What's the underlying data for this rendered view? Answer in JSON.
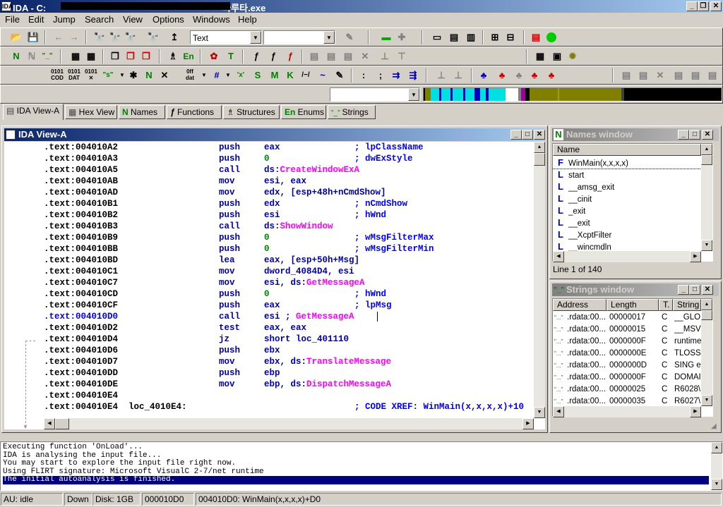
{
  "app": {
    "title": "IDA - C:",
    "title_suffix": "마루타.exe",
    "icon_text": "IDA"
  },
  "menu": [
    "File",
    "Edit",
    "Jump",
    "Search",
    "View",
    "Options",
    "Windows",
    "Help"
  ],
  "toolbar": {
    "segment_combo": "Text",
    "second_combo": ""
  },
  "tabs": [
    {
      "label": "IDA View-A",
      "icon": "ida-view-icon"
    },
    {
      "label": "Hex View",
      "icon": "hex-view-icon"
    },
    {
      "label": "Names",
      "icon": "names-icon"
    },
    {
      "label": "Functions",
      "icon": "functions-icon"
    },
    {
      "label": "Structures",
      "icon": "structures-icon"
    },
    {
      "label": "Enums",
      "icon": "enums-icon"
    },
    {
      "label": "Strings",
      "icon": "strings-icon"
    }
  ],
  "ida_view": {
    "title": "IDA View-A",
    "lines": [
      {
        "addr": ".text:004010A2",
        "label": "",
        "mn": "push",
        "op": "eax",
        "opmark": "",
        "comment": "; lpClassName"
      },
      {
        "addr": ".text:004010A3",
        "label": "",
        "mn": "push",
        "op": "0",
        "opmark": "",
        "comment": "; dwExStyle"
      },
      {
        "addr": ".text:004010A5",
        "label": "",
        "mn": "call",
        "op": "ds:",
        "opmark": "CreateWindowExA",
        "comment": ""
      },
      {
        "addr": ".text:004010AB",
        "label": "",
        "mn": "mov",
        "op": "esi, eax",
        "opmark": "",
        "comment": ""
      },
      {
        "addr": ".text:004010AD",
        "label": "",
        "mn": "mov",
        "op": "edx, [esp+48h+nCmdShow]",
        "opmark": "",
        "comment": ""
      },
      {
        "addr": ".text:004010B1",
        "label": "",
        "mn": "push",
        "op": "edx",
        "opmark": "",
        "comment": "; nCmdShow"
      },
      {
        "addr": ".text:004010B2",
        "label": "",
        "mn": "push",
        "op": "esi",
        "opmark": "",
        "comment": "; hWnd"
      },
      {
        "addr": ".text:004010B3",
        "label": "",
        "mn": "call",
        "op": "ds:",
        "opmark": "ShowWindow",
        "comment": ""
      },
      {
        "addr": ".text:004010B9",
        "label": "",
        "mn": "push",
        "op": "0",
        "opmark": "",
        "comment": "; wMsgFilterMax"
      },
      {
        "addr": ".text:004010BB",
        "label": "",
        "mn": "push",
        "op": "0",
        "opmark": "",
        "comment": "; wMsgFilterMin"
      },
      {
        "addr": ".text:004010BD",
        "label": "",
        "mn": "lea",
        "op": "eax, [esp+50h+Msg]",
        "opmark": "",
        "comment": ""
      },
      {
        "addr": ".text:004010C1",
        "label": "",
        "mn": "mov",
        "op": "dword_4084D4, esi",
        "opmark": "",
        "comment": ""
      },
      {
        "addr": ".text:004010C7",
        "label": "",
        "mn": "mov",
        "op": "esi, ds:",
        "opmark": "GetMessageA",
        "comment": ""
      },
      {
        "addr": ".text:004010CD",
        "label": "",
        "mn": "push",
        "op": "0",
        "opmark": "",
        "comment": "; hWnd"
      },
      {
        "addr": ".text:004010CF",
        "label": "",
        "mn": "push",
        "op": "eax",
        "opmark": "",
        "comment": "; lpMsg"
      },
      {
        "addr": ".text:004010D0",
        "label": "",
        "mn": "call",
        "op": "esi ; ",
        "opmark": "GetMessageA",
        "comment": ""
      },
      {
        "addr": ".text:004010D2",
        "label": "",
        "mn": "test",
        "op": "eax, eax",
        "opmark": "",
        "comment": ""
      },
      {
        "addr": ".text:004010D4",
        "label": "",
        "mn": "jz",
        "op": "short loc_401110",
        "opmark": "",
        "comment": ""
      },
      {
        "addr": ".text:004010D6",
        "label": "",
        "mn": "push",
        "op": "ebx",
        "opmark": "",
        "comment": ""
      },
      {
        "addr": ".text:004010D7",
        "label": "",
        "mn": "mov",
        "op": "ebx, ds:",
        "opmark": "TranslateMessage",
        "comment": ""
      },
      {
        "addr": ".text:004010DD",
        "label": "",
        "mn": "push",
        "op": "ebp",
        "opmark": "",
        "comment": ""
      },
      {
        "addr": ".text:004010DE",
        "label": "",
        "mn": "mov",
        "op": "ebp, ds:",
        "opmark": "DispatchMessageA",
        "comment": ""
      },
      {
        "addr": ".text:004010E4",
        "label": "",
        "mn": "",
        "op": "",
        "opmark": "",
        "comment": ""
      },
      {
        "addr": ".text:004010E4",
        "label": "loc_4010E4:",
        "mn": "",
        "op": "",
        "opmark": "",
        "comment": "; CODE XREF: WinMain(x,x,x,x)+10"
      }
    ]
  },
  "names_window": {
    "title": "Names window",
    "column": "Name",
    "items": [
      {
        "kind": "F",
        "name": "WinMain(x,x,x,x)"
      },
      {
        "kind": "L",
        "name": "start"
      },
      {
        "kind": "L",
        "name": "__amsg_exit"
      },
      {
        "kind": "L",
        "name": "__cinit"
      },
      {
        "kind": "L",
        "name": "_exit"
      },
      {
        "kind": "L",
        "name": "__exit"
      },
      {
        "kind": "L",
        "name": "__XcptFilter"
      },
      {
        "kind": "L",
        "name": "__wincmdln"
      }
    ],
    "status": "Line 1 of 140"
  },
  "strings_window": {
    "title": "Strings window",
    "columns": [
      "Address",
      "Length",
      "T.",
      "String"
    ],
    "rows": [
      {
        "addr": ".rdata:00...",
        "len": "00000017",
        "type": "C",
        "str": "__GLOB"
      },
      {
        "addr": ".rdata:00...",
        "len": "00000015",
        "type": "C",
        "str": "__MSVC"
      },
      {
        "addr": ".rdata:00...",
        "len": "0000000F",
        "type": "C",
        "str": "runtime"
      },
      {
        "addr": ".rdata:00...",
        "len": "0000000E",
        "type": "C",
        "str": "TLOSS"
      },
      {
        "addr": ".rdata:00...",
        "len": "0000000D",
        "type": "C",
        "str": "SING er"
      },
      {
        "addr": ".rdata:00...",
        "len": "0000000F",
        "type": "C",
        "str": "DOMAIN"
      },
      {
        "addr": ".rdata:00...",
        "len": "00000025",
        "type": "C",
        "str": "R6028\\"
      },
      {
        "addr": ".rdata:00...",
        "len": "00000035",
        "type": "C",
        "str": "R6027\\"
      }
    ]
  },
  "output": {
    "lines": [
      "Executing function 'OnLoad'...",
      "IDA is analysing the input file...",
      "You may start to explore the input file right now.",
      "Using FLIRT signature: Microsoft VisualC 2-7/net runtime",
      "The initial autoanalysis is finished."
    ]
  },
  "status": {
    "au": "AU:  idle",
    "dir": "Down",
    "disk": "Disk: 1GB",
    "offset": "000010D0",
    "location": "004010D0: WinMain(x,x,x,x)+D0"
  },
  "colors": {
    "title_active": "#0a246a",
    "mnemonic": "#0000aa",
    "import_name": "#ff00ff",
    "comment": "#0000ff",
    "operand_number": "#008000",
    "highlight_line": "#000080"
  }
}
